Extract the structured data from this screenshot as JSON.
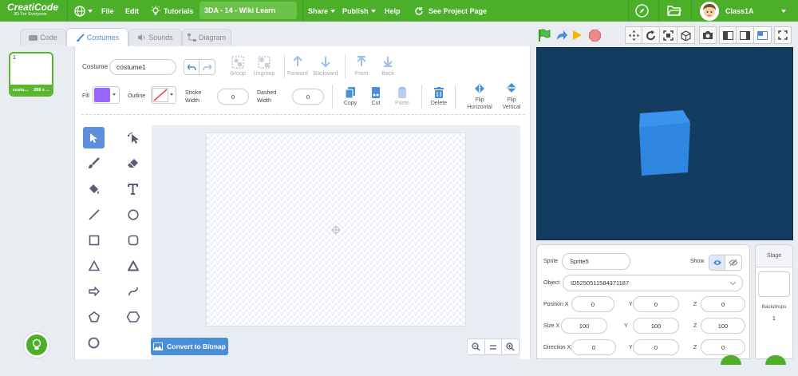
{
  "app": {
    "logo": "CreatiCode",
    "tagline": "3D For Everyone"
  },
  "menu": {
    "file": "File",
    "edit": "Edit",
    "tutorials": "Tutorials",
    "project_title": "3DA - 14 - Wiki Learn",
    "share": "Share",
    "publish": "Publish",
    "help": "Help",
    "see_project": "See Project Page",
    "user": "Class1A"
  },
  "tabs": {
    "code": "Code",
    "costumes": "Costumes",
    "sounds": "Sounds",
    "diagram": "Diagram"
  },
  "costume_list": [
    {
      "number": "1",
      "name": "costu...",
      "size": "288 x ..."
    }
  ],
  "editor": {
    "costume_label": "Costume",
    "costume_name": "costume1",
    "group": "Group",
    "ungroup": "Ungroup",
    "forward": "Forward",
    "backward": "Backward",
    "front": "Front",
    "back": "Back",
    "fill_label": "Fill",
    "outline_label": "Outline",
    "stroke_width_label": "Stroke Width",
    "stroke_width": "0",
    "dashed_width_label": "Dashed Width",
    "dashed_width": "0",
    "copy": "Copy",
    "cut": "Cut",
    "paste": "Paste",
    "delete": "Delete",
    "flip_h": "Flip Horizontal",
    "flip_v": "Flip Vertical",
    "convert": "Convert to Bitmap",
    "fill_color": "#9966ff"
  },
  "sprite": {
    "sprite_label": "Sprite",
    "sprite_name": "Sprite5",
    "show_label": "Show",
    "object_label": "Object",
    "object_value": "ID5250511584371187",
    "position_label": "Position X",
    "pos_x": "0",
    "pos_y": "0",
    "pos_z": "0",
    "size_label": "Size X",
    "size_x": "100",
    "size_y": "100",
    "size_z": "100",
    "direction_label": "Direction X",
    "dir_x": "0",
    "dir_y": "0",
    "dir_z": "0",
    "y_label": "Y",
    "z_label": "Z"
  },
  "stage": {
    "title": "Stage",
    "backdrops_label": "Backdrops",
    "backdrops_count": "1"
  },
  "colors": {
    "topbar": "#4caf2a",
    "stage_bg": "#133c60",
    "cube": "#2f86e0",
    "accent": "#4a8fd6"
  }
}
